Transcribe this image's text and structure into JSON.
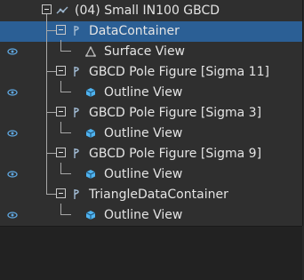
{
  "tree": {
    "root": {
      "label": "(04) Small IN100 GBCD",
      "icon": "pipeline-icon"
    },
    "items": [
      {
        "label": "DataContainer",
        "icon": "data-container-icon",
        "kind": "container",
        "selected": true,
        "visible_eye": false
      },
      {
        "label": "Surface View",
        "icon": "surface-view-icon",
        "kind": "view",
        "visible_eye": true
      },
      {
        "label": "GBCD Pole Figure [Sigma 11]",
        "icon": "data-container-icon",
        "kind": "container",
        "visible_eye": false
      },
      {
        "label": "Outline View",
        "icon": "outline-cube-icon",
        "kind": "view",
        "visible_eye": true
      },
      {
        "label": "GBCD Pole Figure [Sigma 3]",
        "icon": "data-container-icon",
        "kind": "container",
        "visible_eye": false
      },
      {
        "label": "Outline View",
        "icon": "outline-cube-icon",
        "kind": "view",
        "visible_eye": true
      },
      {
        "label": "GBCD Pole Figure [Sigma 9]",
        "icon": "data-container-icon",
        "kind": "container",
        "visible_eye": false
      },
      {
        "label": "Outline View",
        "icon": "outline-cube-icon",
        "kind": "view",
        "visible_eye": true
      },
      {
        "label": "TriangleDataContainer",
        "icon": "data-container-icon",
        "kind": "container",
        "visible_eye": false
      },
      {
        "label": "Outline View",
        "icon": "outline-cube-icon",
        "kind": "view",
        "visible_eye": true
      }
    ]
  },
  "colors": {
    "selection": "#2b5f95",
    "eye": "#5fa7e0",
    "cube": "#4fb3f0",
    "text": "#e4e4e4"
  }
}
